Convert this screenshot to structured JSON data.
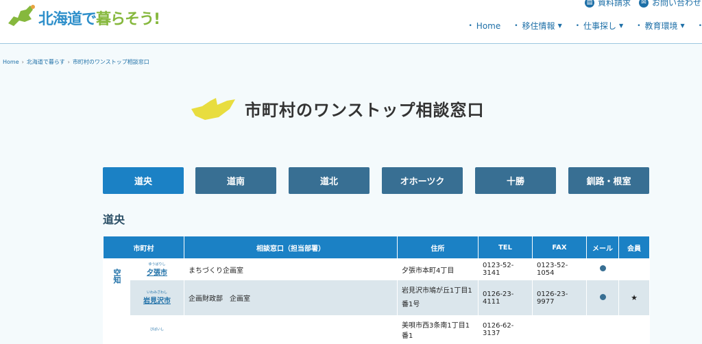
{
  "header": {
    "logo_text_a": "北海道で",
    "logo_text_b": "暮らそう!",
    "top_links": [
      {
        "label": "資料請求",
        "icon": "document-icon"
      },
      {
        "label": "お問い合わせ",
        "icon": "mail-icon"
      }
    ],
    "nav": [
      {
        "label": "Home",
        "dropdown": false
      },
      {
        "label": "移住情報",
        "dropdown": true
      },
      {
        "label": "仕事探し",
        "dropdown": true
      },
      {
        "label": "教育環境",
        "dropdown": true
      }
    ]
  },
  "breadcrumb": [
    "Home",
    "北海道で暮らす",
    "市町村のワンストップ相談窓口"
  ],
  "page_title": "市町村のワンストップ相談窓口",
  "tabs": [
    "道央",
    "道南",
    "道北",
    "オホーツク",
    "十勝",
    "釧路・根室"
  ],
  "active_tab": "道央",
  "section_heading": "道央",
  "table": {
    "headers": [
      "市町村",
      "相談窓口（担当部署）",
      "住所",
      "TEL",
      "FAX",
      "メール",
      "会員"
    ],
    "region": "空知",
    "rows": [
      {
        "ruby": "ゆうばりし",
        "city": "夕張市",
        "dept": "まちづくり企画室",
        "address": "夕張市本町4丁目",
        "tel": "0123-52-3141",
        "fax": "0123-52-1054",
        "mail": "●",
        "member": ""
      },
      {
        "ruby": "いわみざわし",
        "city": "岩見沢市",
        "dept": "企画財政部　企画室",
        "address": "岩見沢市鳩が丘1丁目1番1号",
        "tel": "0126-23-4111",
        "fax": "0126-23-9977",
        "mail": "●",
        "member": "★"
      },
      {
        "ruby": "びばいし",
        "city": "",
        "dept": "",
        "address": "美唄市西3条南1丁目1番1",
        "tel": "0126-62-3137",
        "fax": "",
        "mail": "",
        "member": ""
      }
    ]
  },
  "colors": {
    "primary": "#1b81c5",
    "tab": "#386f93",
    "accent_yellow": "#e8dd3f",
    "logo_green": "#86b83d"
  }
}
